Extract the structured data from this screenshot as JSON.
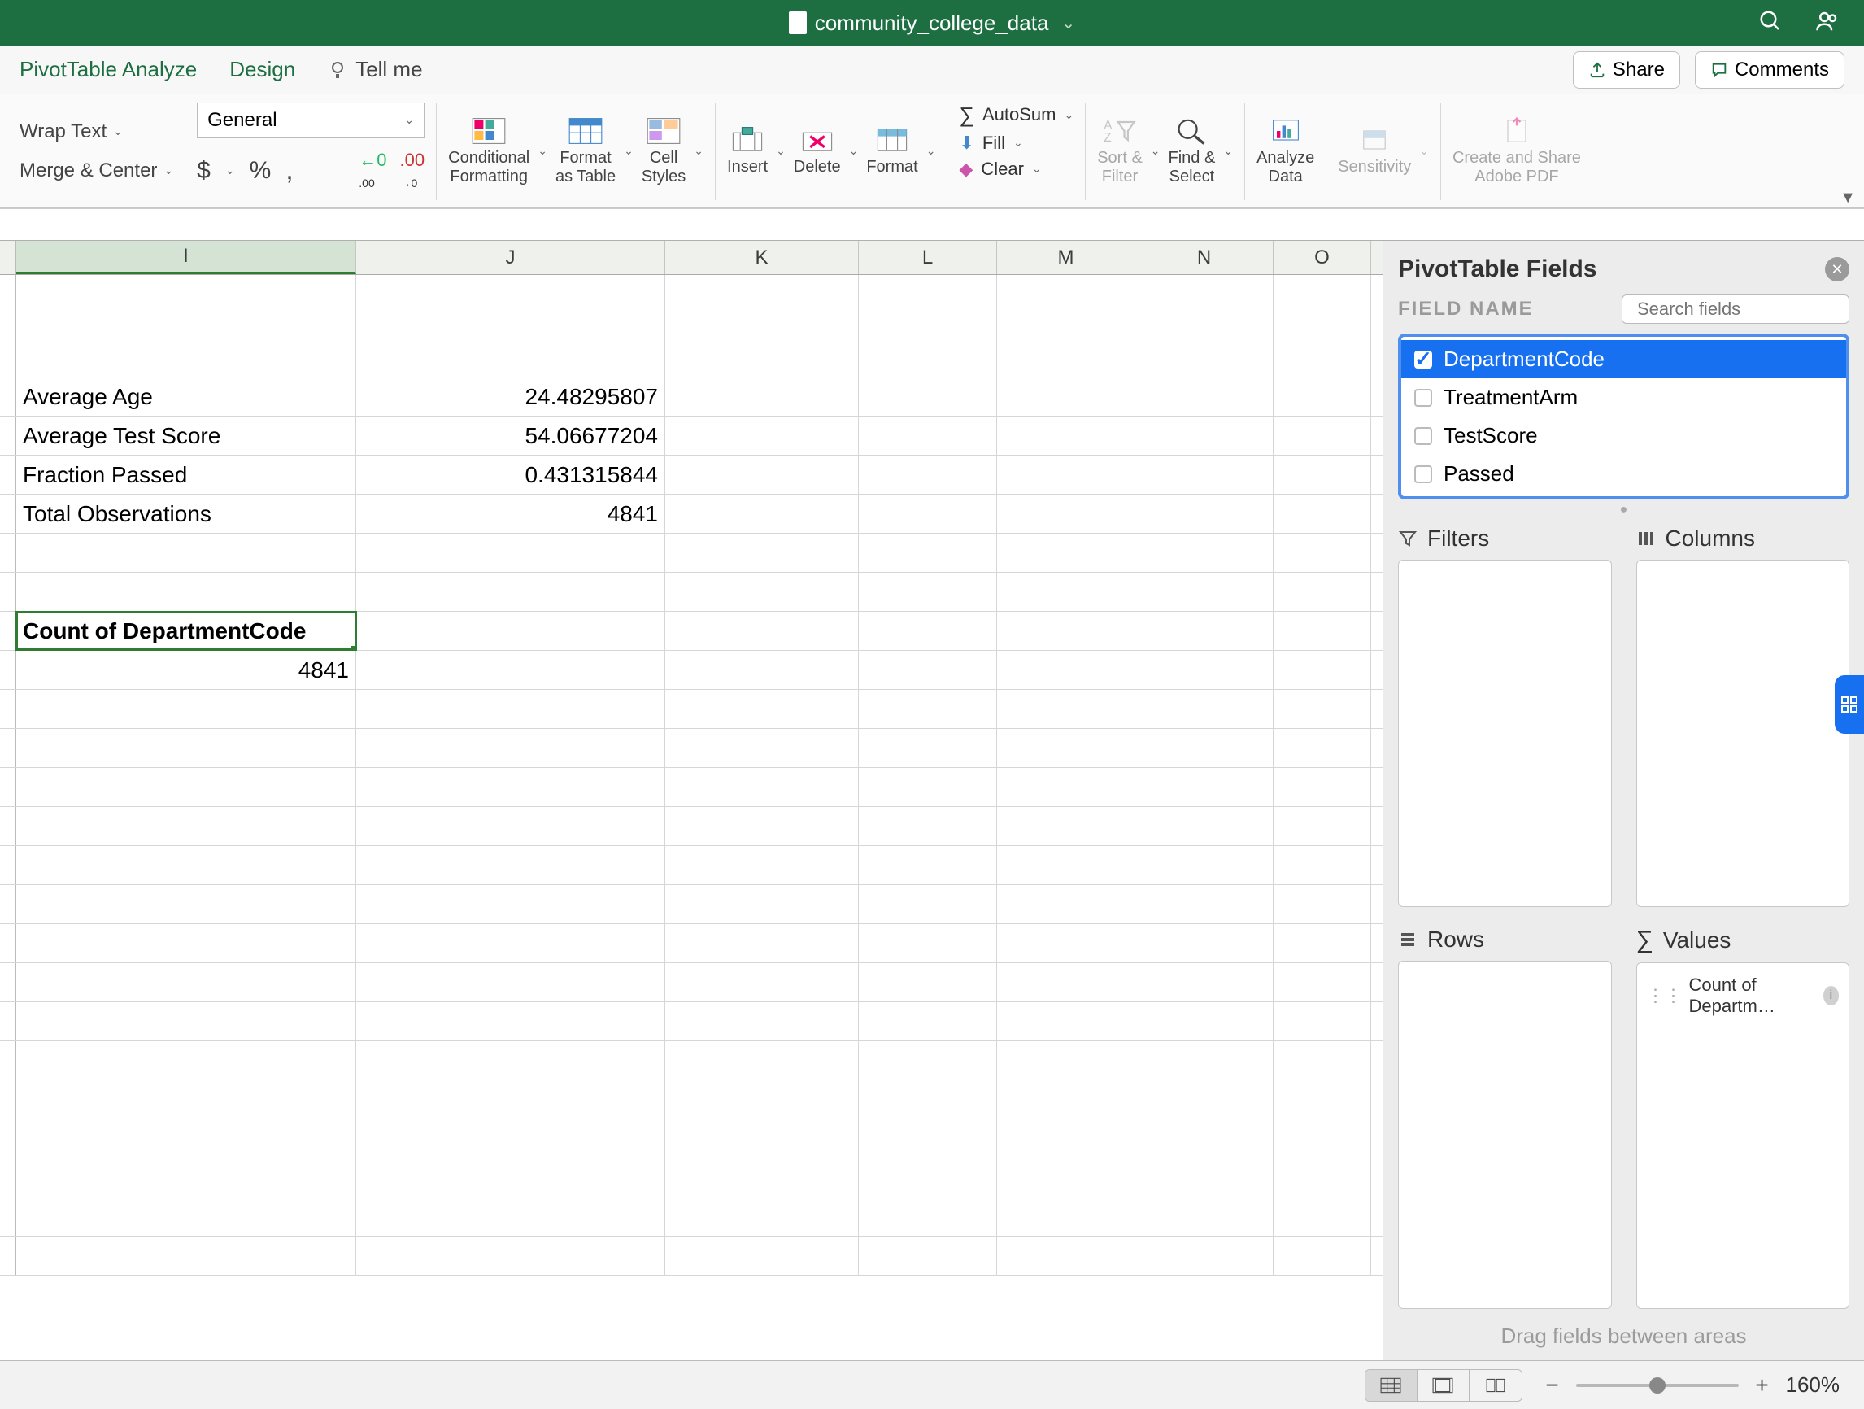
{
  "title": "community_college_data",
  "ribbon_tabs": {
    "analyze": "PivotTable Analyze",
    "design": "Design",
    "tell_me": "Tell me"
  },
  "ribbon_buttons": {
    "share": "Share",
    "comments": "Comments"
  },
  "toolbar": {
    "wrap_text": "Wrap Text",
    "merge_center": "Merge & Center",
    "number_format": "General",
    "conditional": "Conditional\nFormatting",
    "format_table": "Format\nas Table",
    "cell_styles": "Cell\nStyles",
    "insert": "Insert",
    "delete": "Delete",
    "format": "Format",
    "autosum": "AutoSum",
    "fill": "Fill",
    "clear": "Clear",
    "sort_filter": "Sort &\nFilter",
    "find_select": "Find &\nSelect",
    "analyze_data": "Analyze\nData",
    "sensitivity": "Sensitivity",
    "create_share_pdf": "Create and Share\nAdobe PDF"
  },
  "columns": [
    "I",
    "J",
    "K",
    "L",
    "M",
    "N",
    "O"
  ],
  "cells": {
    "avg_age_label": "Average Age",
    "avg_age_val": "24.48295807",
    "avg_score_label": "Average Test Score",
    "avg_score_val": "54.06677204",
    "frac_passed_label": "Fraction Passed",
    "frac_passed_val": "0.431315844",
    "total_obs_label": "Total Observations",
    "total_obs_val": "4841",
    "pivot_header": "Count of DepartmentCode",
    "pivot_val": "4841"
  },
  "pane": {
    "title": "PivotTable Fields",
    "field_name": "FIELD NAME",
    "search_placeholder": "Search fields",
    "fields": {
      "dept": "DepartmentCode",
      "treat": "TreatmentArm",
      "score": "TestScore",
      "passed": "Passed"
    },
    "areas": {
      "filters": "Filters",
      "columns": "Columns",
      "rows": "Rows",
      "values": "Values"
    },
    "value_item": "Count of Departm…",
    "drag_hint": "Drag fields between areas"
  },
  "status": {
    "zoom": "160%"
  }
}
